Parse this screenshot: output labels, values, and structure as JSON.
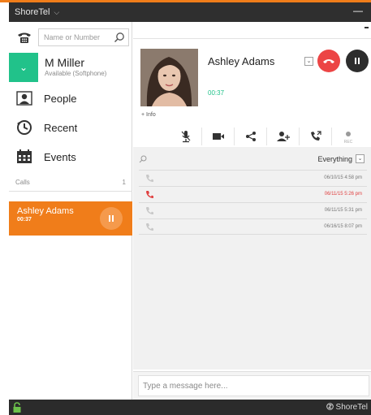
{
  "colors": {
    "accent_orange": "#f07d1a",
    "presence_green": "#21c28a",
    "hangup_red": "#ec4545",
    "titlebar_dark": "#2f2f2f",
    "missed_red": "#e04040"
  },
  "window": {
    "title": "ShoreTel",
    "title_chevron": "⌵",
    "minimize": "—"
  },
  "sidebar": {
    "search": {
      "placeholder": "Name or Number",
      "icon": "search-icon"
    },
    "dialpad_icon": "phone-icon",
    "user": {
      "name": "M Miller",
      "status": "Available (Softphone)",
      "toggle": "⌄"
    },
    "nav": [
      {
        "label": "People",
        "icon": "person-icon"
      },
      {
        "label": "Recent",
        "icon": "clock-icon"
      },
      {
        "label": "Events",
        "icon": "calendar-icon"
      }
    ],
    "calls_section": {
      "label": "Calls",
      "count": "1"
    },
    "active_call": {
      "name": "Ashley Adams",
      "duration": "00:37",
      "hold_icon": "pause-icon"
    }
  },
  "call": {
    "contact_name": "Ashley Adams",
    "timer": "00:37",
    "info_link": "+ Info",
    "dropdown": "⌄",
    "hangup_icon": "hangup-icon",
    "pause_icon": "pause-icon",
    "toolbar": [
      {
        "icon": "mute-mic-icon"
      },
      {
        "icon": "video-icon"
      },
      {
        "icon": "share-icon"
      },
      {
        "icon": "add-person-icon"
      },
      {
        "icon": "transfer-icon"
      },
      {
        "icon": "record-icon",
        "label": "REC"
      }
    ]
  },
  "history": {
    "filter_label": "Everything",
    "filter_dropdown": "⌄",
    "rows": [
      {
        "date": "06/10/15 4:58 pm",
        "missed": false
      },
      {
        "date": "06/11/15 5:26 pm",
        "missed": true
      },
      {
        "date": "06/11/15 5:31 pm",
        "missed": false
      },
      {
        "date": "06/16/15 8:07 pm",
        "missed": false
      }
    ]
  },
  "message": {
    "placeholder": "Type a message here..."
  },
  "statusbar": {
    "brand": "ShoreTel",
    "lock_icon": "lock-icon"
  }
}
